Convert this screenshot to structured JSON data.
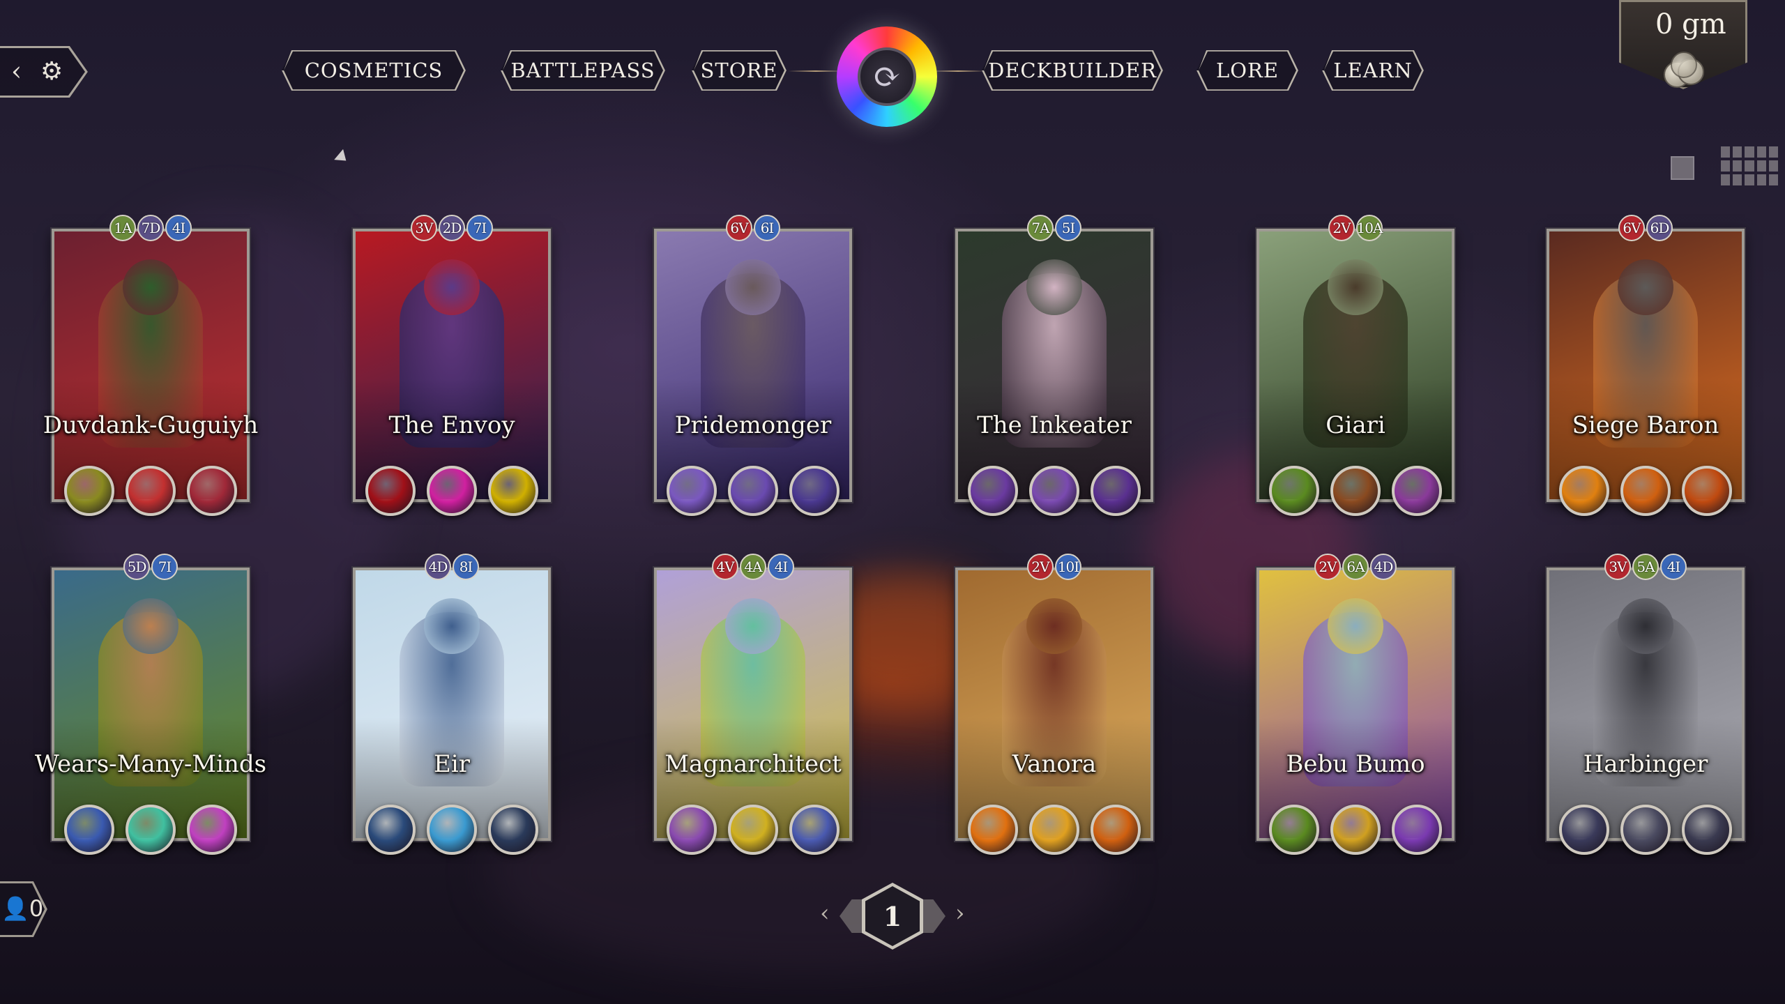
{
  "nav": {
    "cosmetics": "COSMETICS",
    "battlepass": "BATTLEPASS",
    "store": "STORE",
    "deckbuilder": "DECKBUILDER",
    "lore": "LORE",
    "learn": "LEARN"
  },
  "currency": {
    "amount": "0",
    "unit": "gm"
  },
  "pager": {
    "page": "1"
  },
  "friends": {
    "count": "0"
  },
  "colors": {
    "V": "#b3262e",
    "D": "#5a4f86",
    "I": "#3a67b8",
    "A": "#6a8a3a"
  },
  "cards": [
    {
      "name": "Duvdank-Guguiyh",
      "stats": [
        "1A",
        "7D",
        "4I"
      ],
      "art": [
        "#6c2030",
        "#2a5f2c",
        "#c23030"
      ],
      "abilities": [
        "#8a8a20",
        "#c23030",
        "#a02838"
      ]
    },
    {
      "name": "The Envoy",
      "stats": [
        "3V",
        "2D",
        "7I"
      ],
      "art": [
        "#b81a22",
        "#5b3b8a",
        "#2a2254"
      ],
      "abilities": [
        "#a01018",
        "#d020a0",
        "#d0b000"
      ]
    },
    {
      "name": "Pridemonger",
      "stats": [
        "6V",
        "6I"
      ],
      "art": [
        "#8a7ab0",
        "#6a5a5a",
        "#3a2a70"
      ],
      "abilities": [
        "#7a58c0",
        "#6a4ab0",
        "#4a3890"
      ]
    },
    {
      "name": "The Inkeater",
      "stats": [
        "7A",
        "5I"
      ],
      "art": [
        "#2c3a2c",
        "#d8b8c8",
        "#3a2a3a"
      ],
      "abilities": [
        "#6a3aa0",
        "#7a4ab0",
        "#5a3090"
      ]
    },
    {
      "name": "Giari",
      "stats": [
        "2V",
        "10A"
      ],
      "art": [
        "#8aa07a",
        "#4a3a2a",
        "#2a3a20"
      ],
      "abilities": [
        "#5a8a20",
        "#8a4a20",
        "#8a3a9a"
      ]
    },
    {
      "name": "Siege Baron",
      "stats": [
        "6V",
        "6D"
      ],
      "art": [
        "#5a2a20",
        "#5a5a5a",
        "#e07020"
      ],
      "abilities": [
        "#e08010",
        "#d06010",
        "#c04a10"
      ]
    },
    {
      "name": "Wears-Many-Minds",
      "stats": [
        "5D",
        "7I"
      ],
      "art": [
        "#3a6a8a",
        "#c08050",
        "#6a8a20"
      ],
      "abilities": [
        "#3a5ab0",
        "#40c0a0",
        "#c040c0"
      ]
    },
    {
      "name": "Eir",
      "stats": [
        "4D",
        "8I"
      ],
      "art": [
        "#c0d8e8",
        "#3a5a8a",
        "#e8f0f8"
      ],
      "abilities": [
        "#2a4a7a",
        "#3a9ad0",
        "#2a3a5a"
      ]
    },
    {
      "name": "Magnarchitect",
      "stats": [
        "4V",
        "4A",
        "4I"
      ],
      "art": [
        "#b0a0d8",
        "#60c0a0",
        "#d0c040"
      ],
      "abilities": [
        "#8a4ab0",
        "#d0b020",
        "#4a5ab0"
      ]
    },
    {
      "name": "Vanora",
      "stats": [
        "2V",
        "10I"
      ],
      "art": [
        "#a06a30",
        "#6a2a20",
        "#e0b060"
      ],
      "abilities": [
        "#e07010",
        "#e0a020",
        "#d06010"
      ]
    },
    {
      "name": "Bebu Bumo",
      "stats": [
        "2V",
        "6A",
        "4D"
      ],
      "art": [
        "#e0c040",
        "#8ab0c0",
        "#8a4ab0"
      ],
      "abilities": [
        "#5a8a20",
        "#d0a020",
        "#7a3ab0"
      ]
    },
    {
      "name": "Harbinger",
      "stats": [
        "3V",
        "5A",
        "4I"
      ],
      "art": [
        "#707078",
        "#2a2a30",
        "#b0b0b8"
      ],
      "abilities": [
        "#3a3a5a",
        "#4a4a60",
        "#3a3a50"
      ]
    }
  ]
}
